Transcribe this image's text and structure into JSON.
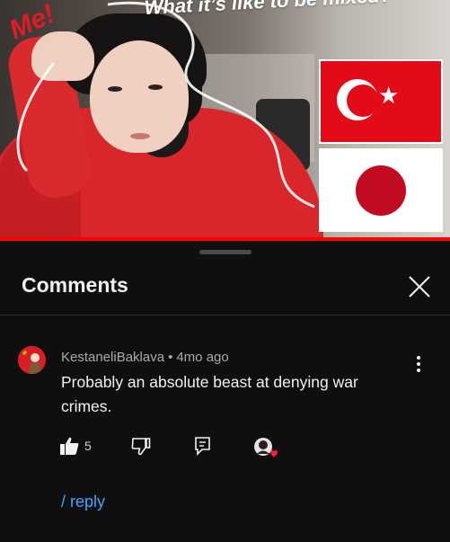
{
  "video": {
    "title_overlay": "What it’s like to be mixed?",
    "label": "Me!",
    "progress_fraction": 1.0,
    "colors": {
      "progress": "#ff0000",
      "turkey_flag": "#e20b17",
      "japan_sun": "#c20a23"
    }
  },
  "comments_panel": {
    "title": "Comments",
    "close_icon": "close-icon"
  },
  "comment": {
    "author": "KestaneliBaklava",
    "separator": "•",
    "age": "4mo ago",
    "text": "Probably an absolute beast at denying war crimes.",
    "like_count": "5",
    "reply_label": "/ reply",
    "icons": [
      "thumbs-up-icon",
      "thumbs-down-icon",
      "reply-comment-icon",
      "creator-heart-icon",
      "more-vert-icon"
    ]
  }
}
